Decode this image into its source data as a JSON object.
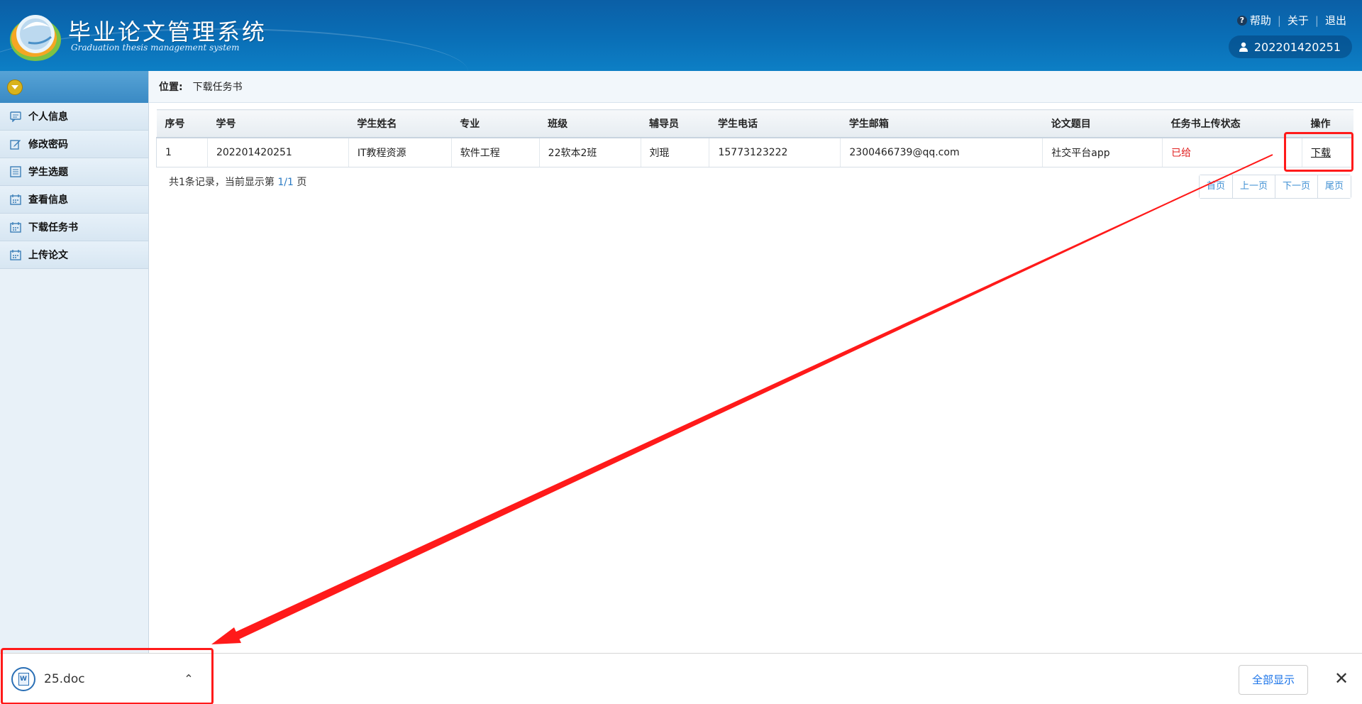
{
  "header": {
    "title": "毕业论文管理系统",
    "subtitle": "Graduation thesis management system",
    "links": {
      "help": "帮助",
      "about": "关于",
      "logout": "退出"
    },
    "username": "202201420251"
  },
  "sidebar": {
    "items": [
      {
        "label": "个人信息",
        "icon": "chat-icon"
      },
      {
        "label": "修改密码",
        "icon": "edit-icon"
      },
      {
        "label": "学生选题",
        "icon": "list-icon"
      },
      {
        "label": "查看信息",
        "icon": "calendar-icon"
      },
      {
        "label": "下载任务书",
        "icon": "calendar-icon"
      },
      {
        "label": "上传论文",
        "icon": "calendar-icon"
      }
    ]
  },
  "breadcrumb": {
    "label": "位置:",
    "value": "下载任务书"
  },
  "table": {
    "headers": [
      "序号",
      "学号",
      "学生姓名",
      "专业",
      "班级",
      "辅导员",
      "学生电话",
      "学生邮箱",
      "论文题目",
      "任务书上传状态",
      "操作"
    ],
    "rows": [
      [
        "1",
        "202201420251",
        "IT教程资源",
        "软件工程",
        "22软本2班",
        "刘琨",
        "15773123222",
        "2300466739@qq.com",
        "社交平台app",
        "已给",
        "下载"
      ]
    ]
  },
  "records": {
    "prefix": "共1条记录，当前显示第",
    "page": "1/1",
    "suffix": "页"
  },
  "pager": {
    "first": "首页",
    "prev": "上一页",
    "next": "下一页",
    "last": "尾页"
  },
  "download_bar": {
    "file_name": "25.doc",
    "show_all": "全部显示"
  },
  "colors": {
    "header": "#0a6fb7",
    "accent_red": "#ff1a1a",
    "status": "#e02020",
    "link_blue": "#1a73e8"
  }
}
